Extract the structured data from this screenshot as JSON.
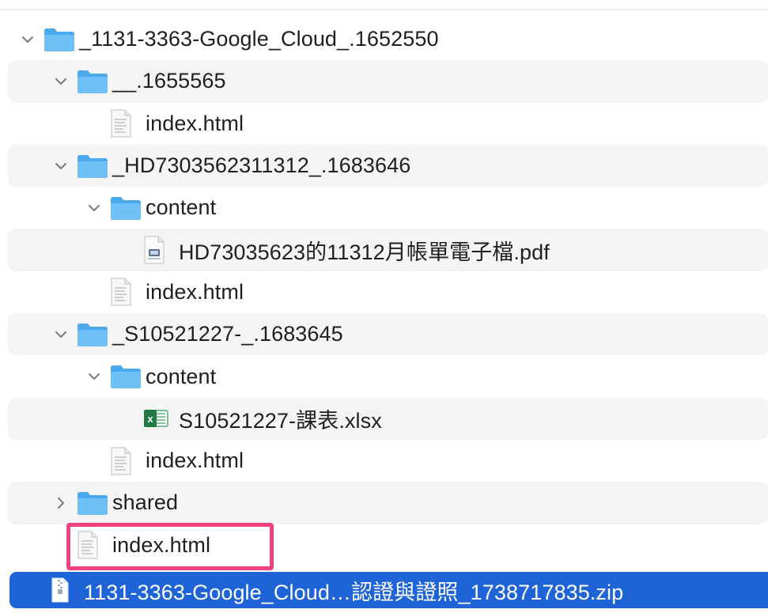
{
  "rows": [
    {
      "label": "_1131-3363-Google_Cloud_.1652550",
      "icon": "folder-icon",
      "expanded": true
    },
    {
      "label": "__.1655565",
      "icon": "folder-icon",
      "expanded": true
    },
    {
      "label": "index.html",
      "icon": "html-file-icon"
    },
    {
      "label": "_HD7303562311312_.1683646",
      "icon": "folder-icon",
      "expanded": true
    },
    {
      "label": "content",
      "icon": "folder-icon",
      "expanded": true
    },
    {
      "label": "HD73035623的11312月帳單電子檔.pdf",
      "icon": "pdf-file-icon"
    },
    {
      "label": "index.html",
      "icon": "html-file-icon"
    },
    {
      "label": "_S10521227-_.1683645",
      "icon": "folder-icon",
      "expanded": true
    },
    {
      "label": "content",
      "icon": "folder-icon",
      "expanded": true
    },
    {
      "label": "S10521227-課表.xlsx",
      "icon": "excel-file-icon"
    },
    {
      "label": "index.html",
      "icon": "html-file-icon"
    },
    {
      "label": "shared",
      "icon": "folder-icon",
      "expanded": false
    },
    {
      "label": "index.html",
      "icon": "html-file-icon"
    }
  ],
  "selected": {
    "label": "1131-3363-Google_Cloud…認證與證照_1738717835.zip",
    "icon": "zip-file-icon"
  },
  "colors": {
    "folder": "#5bb8f5",
    "selection": "#1e64d6",
    "highlight_box": "#f1417e",
    "alt_row": "#f4f4f4"
  }
}
